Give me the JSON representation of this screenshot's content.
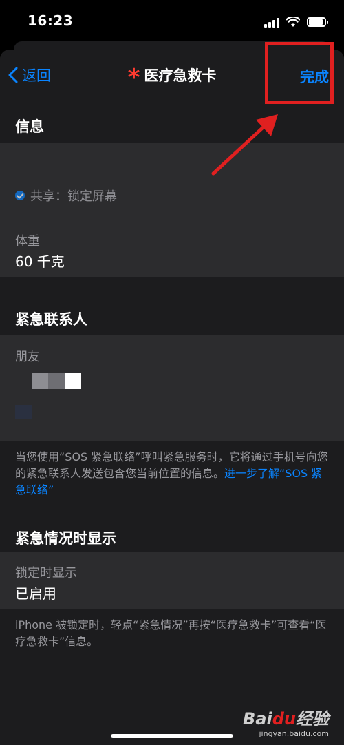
{
  "status_bar": {
    "time": "16:23"
  },
  "nav": {
    "back_label": "返回",
    "title": "医疗急救卡",
    "done_label": "完成"
  },
  "info_section": {
    "header": "信息",
    "share_text": "共享：锁定屏幕",
    "weight_label": "体重",
    "weight_value": "60 千克"
  },
  "emergency_contacts": {
    "header": "紧急联系人",
    "contact_relation": "朋友",
    "note_text": "当您使用“SOS 紧急联络”呼叫紧急服务时，它将通过手机号向您的紧急联系人发送包含您当前位置的信息。",
    "note_link": "进一步了解“SOS 紧急联络”"
  },
  "emergency_access": {
    "header": "紧急情况时显示",
    "lock_label": "锁定时显示",
    "lock_value": "已启用",
    "note_text": "iPhone 被锁定时，轻点“紧急情况”再按“医疗急救卡”可查看“医疗急救卡”信息。"
  },
  "watermark": {
    "logo_a": "Bai",
    "logo_b": "du",
    "logo_c": "经验",
    "url": "jingyan.baidu.com"
  },
  "colors": {
    "accent": "#0a84ff",
    "annotation": "#e02020",
    "star": "#ff3b30"
  }
}
